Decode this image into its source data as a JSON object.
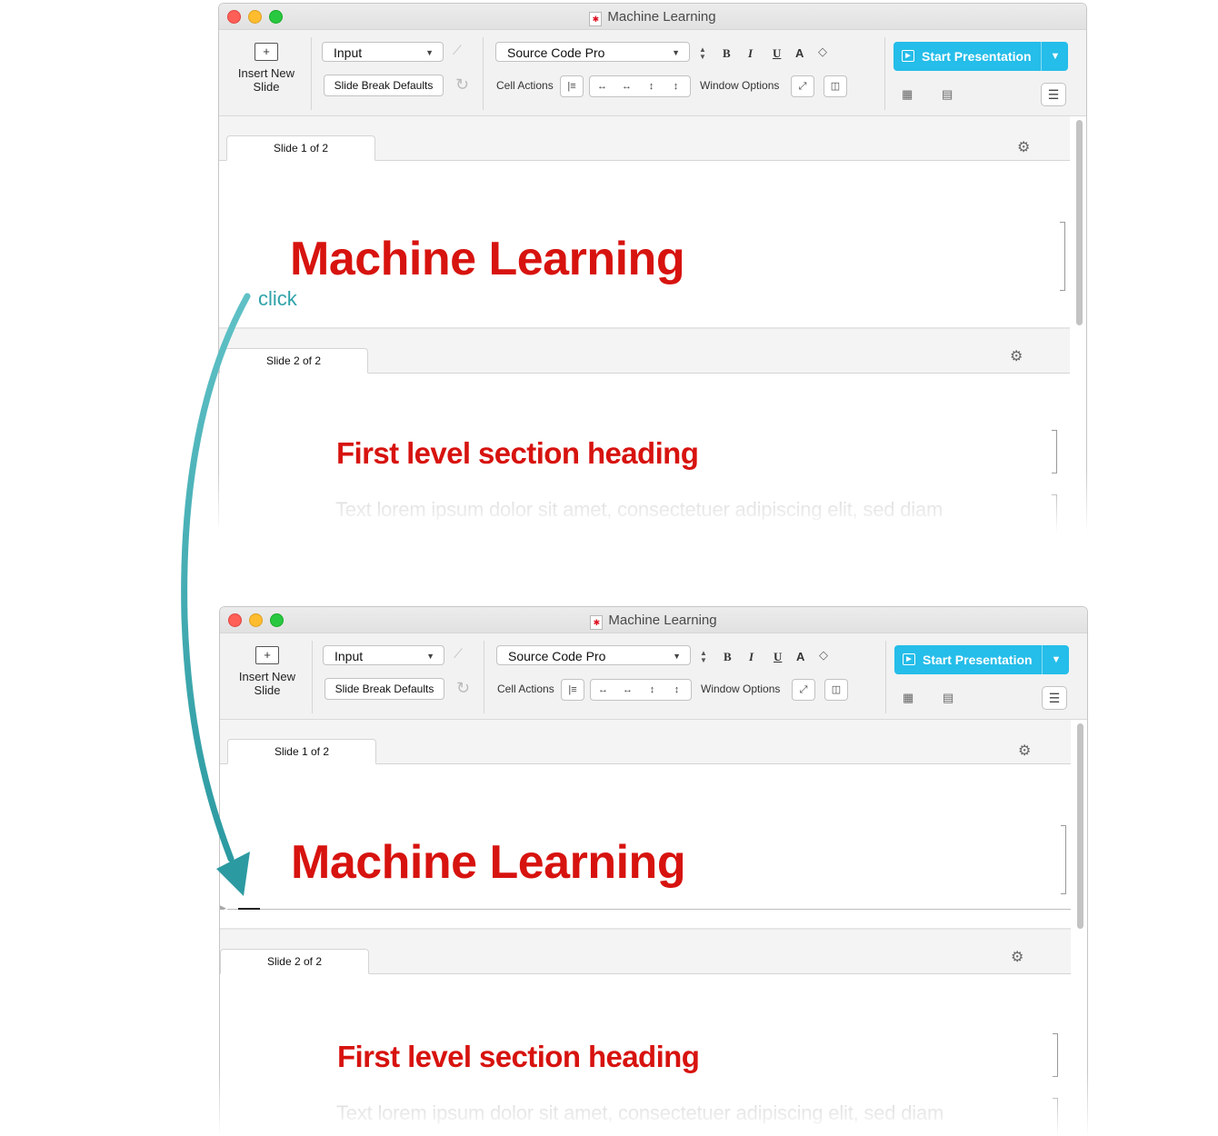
{
  "window": {
    "title": "Machine Learning"
  },
  "toolbar": {
    "insert_new_slide_line1": "Insert New",
    "insert_new_slide_line2": "Slide",
    "cell_style_value": "Input",
    "slide_break_defaults": "Slide Break Defaults",
    "font_value": "Source Code Pro",
    "bold": "B",
    "italic": "I",
    "underline": "U",
    "text_color": "A",
    "cell_actions_label": "Cell Actions",
    "window_options_label": "Window Options",
    "start_presentation": "Start Presentation"
  },
  "slides": {
    "slide1_tab": "Slide 1 of 2",
    "slide2_tab": "Slide 2 of 2",
    "slide1_title": "Machine Learning",
    "slide2_heading": "First level section heading",
    "slide2_text": "Text lorem ipsum dolor sit amet, consectetuer adipiscing elit, sed diam"
  },
  "annotation": {
    "click": "click"
  },
  "colors": {
    "title_red": "#d7130f",
    "accent_blue": "#25bde9",
    "annotation_teal": "#2fa3a9"
  }
}
